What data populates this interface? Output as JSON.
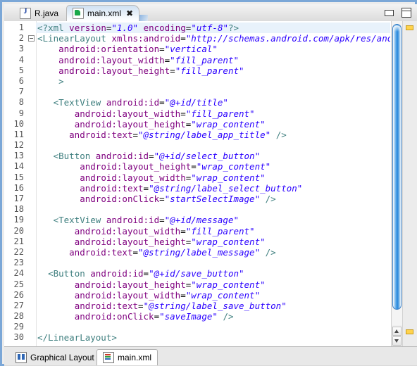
{
  "window": {
    "minimize_label": "Minimize",
    "maximize_label": "Maximize"
  },
  "editor_tabs": [
    {
      "label": "R.java",
      "icon": "java-file-icon",
      "active": false,
      "closable": false
    },
    {
      "label": "main.xml",
      "icon": "xml-file-icon",
      "active": true,
      "closable": true,
      "close_glyph": "✖"
    }
  ],
  "bottom_tabs": [
    {
      "label": "Graphical Layout",
      "icon": "layout-preview-icon",
      "active": false
    },
    {
      "label": "main.xml",
      "icon": "xml-source-icon",
      "active": true
    }
  ],
  "code": {
    "language": "xml",
    "total_lines": 30,
    "lines": [
      {
        "n": "1",
        "fold": false,
        "highlight": true,
        "text": "<?xml version=\"1.0\" encoding=\"utf-8\"?>"
      },
      {
        "n": "2",
        "fold": true,
        "highlight": false,
        "text": "<LinearLayout xmlns:android=\"http://schemas.android.com/apk/res/android\""
      },
      {
        "n": "3",
        "fold": false,
        "highlight": false,
        "text": "    android:orientation=\"vertical\""
      },
      {
        "n": "4",
        "fold": false,
        "highlight": false,
        "text": "    android:layout_width=\"fill_parent\""
      },
      {
        "n": "5",
        "fold": false,
        "highlight": false,
        "text": "    android:layout_height=\"fill_parent\""
      },
      {
        "n": "6",
        "fold": false,
        "highlight": false,
        "text": "    >"
      },
      {
        "n": "7",
        "fold": false,
        "highlight": false,
        "text": ""
      },
      {
        "n": "8",
        "fold": false,
        "highlight": false,
        "text": "   <TextView android:id=\"@+id/title\""
      },
      {
        "n": "9",
        "fold": false,
        "highlight": false,
        "text": "       android:layout_width=\"fill_parent\""
      },
      {
        "n": "10",
        "fold": false,
        "highlight": false,
        "text": "       android:layout_height=\"wrap_content\""
      },
      {
        "n": "11",
        "fold": false,
        "highlight": false,
        "text": "      android:text=\"@string/label_app_title\" />"
      },
      {
        "n": "12",
        "fold": false,
        "highlight": false,
        "text": ""
      },
      {
        "n": "13",
        "fold": false,
        "highlight": false,
        "text": "   <Button android:id=\"@+id/select_button\""
      },
      {
        "n": "14",
        "fold": false,
        "highlight": false,
        "text": "        android:layout_height=\"wrap_content\""
      },
      {
        "n": "15",
        "fold": false,
        "highlight": false,
        "text": "        android:layout_width=\"wrap_content\""
      },
      {
        "n": "16",
        "fold": false,
        "highlight": false,
        "text": "        android:text=\"@string/label_select_button\""
      },
      {
        "n": "17",
        "fold": false,
        "highlight": false,
        "text": "        android:onClick=\"startSelectImage\" />"
      },
      {
        "n": "18",
        "fold": false,
        "highlight": false,
        "text": ""
      },
      {
        "n": "19",
        "fold": false,
        "highlight": false,
        "text": "   <TextView android:id=\"@+id/message\""
      },
      {
        "n": "20",
        "fold": false,
        "highlight": false,
        "text": "       android:layout_width=\"fill_parent\""
      },
      {
        "n": "21",
        "fold": false,
        "highlight": false,
        "text": "       android:layout_height=\"wrap_content\""
      },
      {
        "n": "22",
        "fold": false,
        "highlight": false,
        "text": "      android:text=\"@string/label_message\" />"
      },
      {
        "n": "23",
        "fold": false,
        "highlight": false,
        "text": ""
      },
      {
        "n": "24",
        "fold": false,
        "highlight": false,
        "text": "  <Button android:id=\"@+id/save_button\""
      },
      {
        "n": "25",
        "fold": false,
        "highlight": false,
        "text": "       android:layout_height=\"wrap_content\""
      },
      {
        "n": "26",
        "fold": false,
        "highlight": false,
        "text": "       android:layout_width=\"wrap_content\""
      },
      {
        "n": "27",
        "fold": false,
        "highlight": false,
        "text": "       android:text=\"@string/label_save_button\""
      },
      {
        "n": "28",
        "fold": false,
        "highlight": false,
        "text": "       android:onClick=\"saveImage\" />"
      },
      {
        "n": "29",
        "fold": false,
        "highlight": false,
        "text": ""
      },
      {
        "n": "30",
        "fold": false,
        "highlight": false,
        "text": "</LinearLayout>"
      }
    ]
  },
  "scrollbar": {
    "orientation": "vertical",
    "up_arrow_glyph": "▲",
    "down_arrow_glyph": "▼",
    "thumb_fraction": 0.9
  },
  "overview_ruler": {
    "markers": [
      {
        "name": "annotation-marker-top",
        "color": "#ffd34d"
      },
      {
        "name": "annotation-marker-bottom",
        "color": "#ffd34d"
      }
    ]
  },
  "colors": {
    "tag": "#3f7f7f",
    "attribute": "#7f007f",
    "value": "#2a00ff",
    "text": "#000000",
    "highlight_line": "#e8f2fb",
    "frame_border": "#7ba7d7",
    "scroll_thumb": "#3f9ae4",
    "marker": "#ffd34d"
  }
}
